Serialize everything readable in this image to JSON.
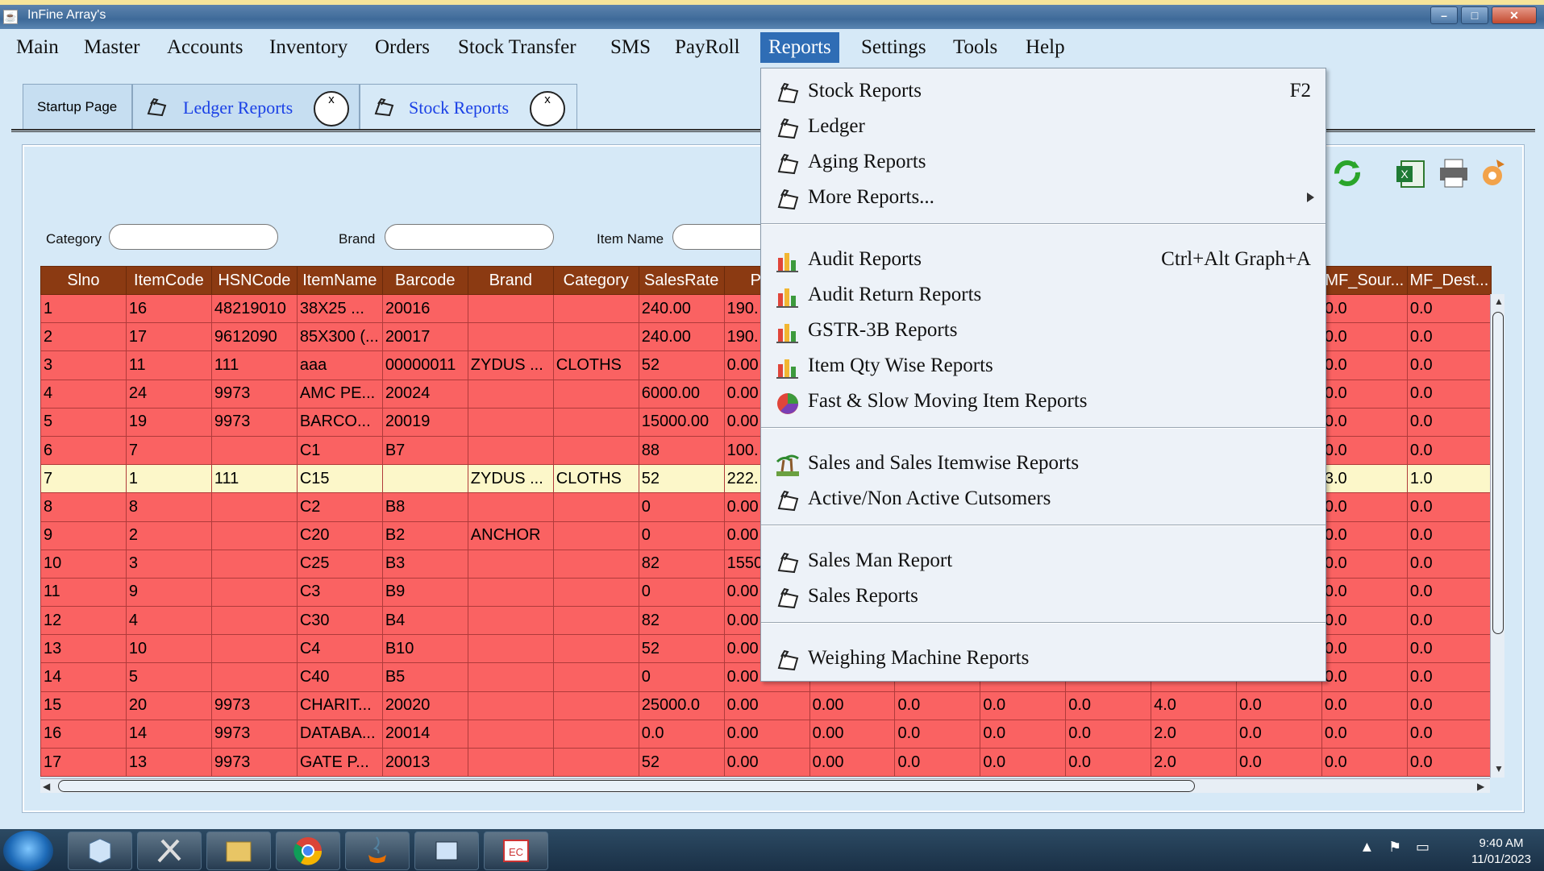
{
  "window": {
    "title": "InFine Array's",
    "controls": [
      "–",
      "□",
      "✕"
    ]
  },
  "menubar": {
    "items": [
      "Main",
      "Master",
      "Accounts",
      "Inventory",
      "Orders",
      "Stock Transfer",
      "SMS",
      "PayRoll",
      "Reports",
      "Settings",
      "Tools",
      "Help"
    ],
    "active": "Reports"
  },
  "tabs": [
    {
      "label": "Startup Page",
      "close": ""
    },
    {
      "label": "Ledger Reports",
      "close": "x"
    },
    {
      "label": "Stock Reports",
      "close": "x"
    }
  ],
  "filters": {
    "category_label": "Category",
    "brand_label": "Brand",
    "item_name_label": "Item Name"
  },
  "table": {
    "columns": [
      "Slno",
      "ItemCode",
      "HSNCode",
      "ItemName",
      "Barcode",
      "Brand",
      "Category",
      "SalesRate",
      "Purc",
      "",
      "",
      "",
      "",
      "",
      "",
      "MF_Sour...",
      "MF_Dest..."
    ],
    "rows": [
      [
        "1",
        "16",
        "48219010",
        "38X25 ...",
        "20016",
        "",
        "",
        "240.00",
        "190.",
        "",
        "",
        "",
        "",
        "",
        "",
        "0.0",
        "0.0"
      ],
      [
        "2",
        "17",
        "9612090",
        "85X300 (...",
        "20017",
        "",
        "",
        "240.00",
        "190.",
        "",
        "",
        "",
        "",
        "",
        "",
        "0.0",
        "0.0"
      ],
      [
        "3",
        "11",
        "111",
        "aaa",
        "00000011",
        "ZYDUS ...",
        "CLOTHS",
        "52",
        "0.00",
        "",
        "",
        "",
        "",
        "",
        "",
        "0.0",
        "0.0"
      ],
      [
        "4",
        "24",
        "9973",
        "AMC PE...",
        "20024",
        "",
        "",
        "6000.00",
        "0.00",
        "",
        "",
        "",
        "",
        "",
        "",
        "0.0",
        "0.0"
      ],
      [
        "5",
        "19",
        "9973",
        "BARCO...",
        "20019",
        "",
        "",
        "15000.00",
        "0.00",
        "",
        "",
        "",
        "",
        "",
        "",
        "0.0",
        "0.0"
      ],
      [
        "6",
        "7",
        "",
        "C1",
        "B7",
        "",
        "",
        "88",
        "100.",
        "",
        "",
        "",
        "",
        "",
        "",
        "0.0",
        "0.0"
      ],
      [
        "7",
        "1",
        "111",
        "C15",
        "",
        "ZYDUS ...",
        "CLOTHS",
        "52",
        "222.",
        "",
        "",
        "",
        "",
        "",
        "",
        "3.0",
        "1.0"
      ],
      [
        "8",
        "8",
        "",
        "C2",
        "B8",
        "",
        "",
        "0",
        "0.00",
        "",
        "",
        "",
        "",
        "",
        "",
        "0.0",
        "0.0"
      ],
      [
        "9",
        "2",
        "",
        "C20",
        "B2",
        "ANCHOR",
        "",
        "0",
        "0.00",
        "",
        "",
        "",
        "",
        "",
        "",
        "0.0",
        "0.0"
      ],
      [
        "10",
        "3",
        "",
        "C25",
        "B3",
        "",
        "",
        "82",
        "1550",
        "",
        "",
        "",
        "",
        "",
        "",
        "0.0",
        "0.0"
      ],
      [
        "11",
        "9",
        "",
        "C3",
        "B9",
        "",
        "",
        "0",
        "0.00",
        "",
        "",
        "",
        "",
        "",
        "",
        "0.0",
        "0.0"
      ],
      [
        "12",
        "4",
        "",
        "C30",
        "B4",
        "",
        "",
        "82",
        "0.00",
        "",
        "",
        "",
        "",
        "",
        "",
        "0.0",
        "0.0"
      ],
      [
        "13",
        "10",
        "",
        "C4",
        "B10",
        "",
        "",
        "52",
        "0.00",
        "",
        "",
        "",
        "",
        "",
        "",
        "0.0",
        "0.0"
      ],
      [
        "14",
        "5",
        "",
        "C40",
        "B5",
        "",
        "",
        "0",
        "0.00",
        "",
        "",
        "",
        "",
        "",
        "",
        "0.0",
        "0.0"
      ],
      [
        "15",
        "20",
        "9973",
        "CHARIT...",
        "20020",
        "",
        "",
        "25000.0",
        "0.00",
        "0.00",
        "0.0",
        "0.0",
        "0.0",
        "4.0",
        "0.0",
        "0.0",
        "0.0"
      ],
      [
        "16",
        "14",
        "9973",
        "DATABA...",
        "20014",
        "",
        "",
        "0.0",
        "0.00",
        "0.00",
        "0.0",
        "0.0",
        "0.0",
        "2.0",
        "0.0",
        "0.0",
        "0.0"
      ],
      [
        "17",
        "13",
        "9973",
        "GATE P...",
        "20013",
        "",
        "",
        "52",
        "0.00",
        "0.00",
        "0.0",
        "0.0",
        "0.0",
        "2.0",
        "0.0",
        "0.0",
        "0.0"
      ]
    ],
    "selected_row": 6
  },
  "reports_menu": {
    "groups": [
      [
        {
          "label": "Stock Reports",
          "shortcut": "F2",
          "icon": "clapper-icon"
        },
        {
          "label": "Ledger",
          "shortcut": "",
          "icon": "clapper-icon"
        },
        {
          "label": "Aging Reports",
          "shortcut": "",
          "icon": "clapper-icon"
        },
        {
          "label": "More Reports...",
          "shortcut": "",
          "icon": "clapper-icon",
          "submenu": true
        }
      ],
      [
        {
          "label": "Audit Reports",
          "shortcut": "Ctrl+Alt Graph+A",
          "icon": "bar-chart-icon"
        },
        {
          "label": "Audit Return Reports",
          "shortcut": "",
          "icon": "bar-chart-icon"
        },
        {
          "label": "GSTR-3B Reports",
          "shortcut": "",
          "icon": "bar-chart-icon"
        },
        {
          "label": "Item Qty Wise Reports",
          "shortcut": "",
          "icon": "bar-chart-icon"
        },
        {
          "label": "Fast & Slow Moving Item Reports",
          "shortcut": "",
          "icon": "pie-chart-icon"
        }
      ],
      [
        {
          "label": "Sales and Sales Itemwise Reports",
          "shortcut": "",
          "icon": "palm-tree-icon"
        },
        {
          "label": "Active/Non Active Cutsomers",
          "shortcut": "",
          "icon": "clapper-icon"
        }
      ],
      [
        {
          "label": "Sales Man Report",
          "shortcut": "",
          "icon": "clapper-icon"
        },
        {
          "label": "Sales Reports",
          "shortcut": "",
          "icon": "clapper-icon"
        }
      ],
      [
        {
          "label": "Weighing Machine Reports",
          "shortcut": "",
          "icon": "clapper-icon"
        }
      ]
    ]
  },
  "taskbar": {
    "apps": [
      "box-icon",
      "tools-icon",
      "folder-icon",
      "chrome-icon",
      "java-icon",
      "window-icon",
      "ec-icon"
    ],
    "time": "9:40 AM",
    "date": "11/01/2023"
  },
  "colors": {
    "header_bg": "#8b3a12",
    "row_bg": "#fa6262",
    "selected_row_bg": "#fcf7c9",
    "menu_active": "#2f6db5"
  }
}
